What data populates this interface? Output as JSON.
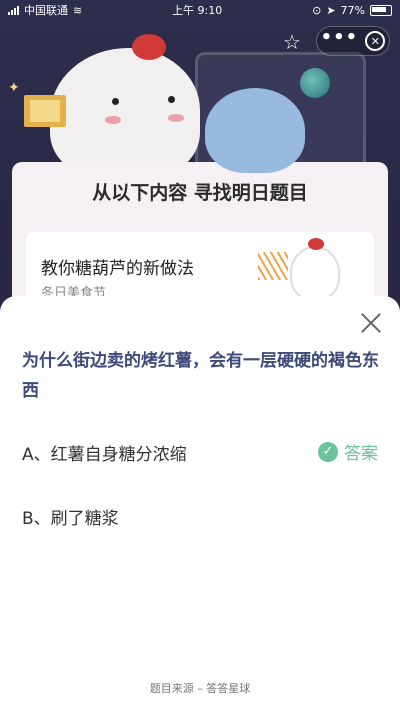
{
  "status_bar": {
    "carrier": "中国联通",
    "time": "上午 9:10",
    "battery": "77%"
  },
  "background": {
    "banner_title": "从以下内容  寻找明日题目",
    "article_title": "教你糖葫芦的新做法",
    "article_meta": "冬日美食节"
  },
  "nav": {
    "more_label": "•••",
    "close_label": "✕",
    "star_label": "☆"
  },
  "sheet": {
    "question": "为什么街边卖的烤红薯，会有一层硬硬的褐色东西",
    "options": [
      {
        "label": "A、红薯自身糖分浓缩"
      },
      {
        "label": "B、刷了糖浆"
      }
    ],
    "answer_label": "答案",
    "source": "题目来源 – 答答星球"
  },
  "colors": {
    "accent": "#6bc39a",
    "question": "#3d4a7a"
  }
}
